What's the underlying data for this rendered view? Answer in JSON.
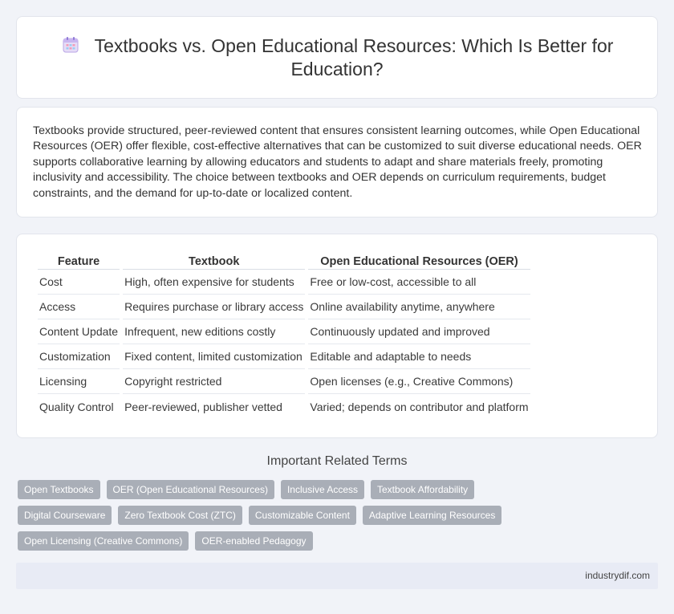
{
  "header": {
    "title": "Textbooks vs. Open Educational Resources: Which Is Better for Education?",
    "icon": "calendar-icon"
  },
  "intro": {
    "text": "Textbooks provide structured, peer-reviewed content that ensures consistent learning outcomes, while Open Educational Resources (OER) offer flexible, cost-effective alternatives that can be customized to suit diverse educational needs. OER supports collaborative learning by allowing educators and students to adapt and share materials freely, promoting inclusivity and accessibility. The choice between textbooks and OER depends on curriculum requirements, budget constraints, and the demand for up-to-date or localized content."
  },
  "table": {
    "headers": [
      "Feature",
      "Textbook",
      "Open Educational Resources (OER)"
    ],
    "rows": [
      [
        "Cost",
        "High, often expensive for students",
        "Free or low-cost, accessible to all"
      ],
      [
        "Access",
        "Requires purchase or library access",
        "Online availability anytime, anywhere"
      ],
      [
        "Content Update",
        "Infrequent, new editions costly",
        "Continuously updated and improved"
      ],
      [
        "Customization",
        "Fixed content, limited customization",
        "Editable and adaptable to needs"
      ],
      [
        "Licensing",
        "Copyright restricted",
        "Open licenses (e.g., Creative Commons)"
      ],
      [
        "Quality Control",
        "Peer-reviewed, publisher vetted",
        "Varied; depends on contributor and platform"
      ]
    ]
  },
  "related": {
    "heading": "Important Related Terms",
    "tags": [
      "Open Textbooks",
      "OER (Open Educational Resources)",
      "Inclusive Access",
      "Textbook Affordability",
      "Digital Courseware",
      "Zero Textbook Cost (ZTC)",
      "Customizable Content",
      "Adaptive Learning Resources",
      "Open Licensing (Creative Commons)",
      "OER-enabled Pedagogy"
    ]
  },
  "footer": {
    "site": "industrydif.com"
  },
  "colors": {
    "background": "#f1f3f8",
    "tag": "#a9aeb7",
    "footer": "#e8ebf5"
  }
}
